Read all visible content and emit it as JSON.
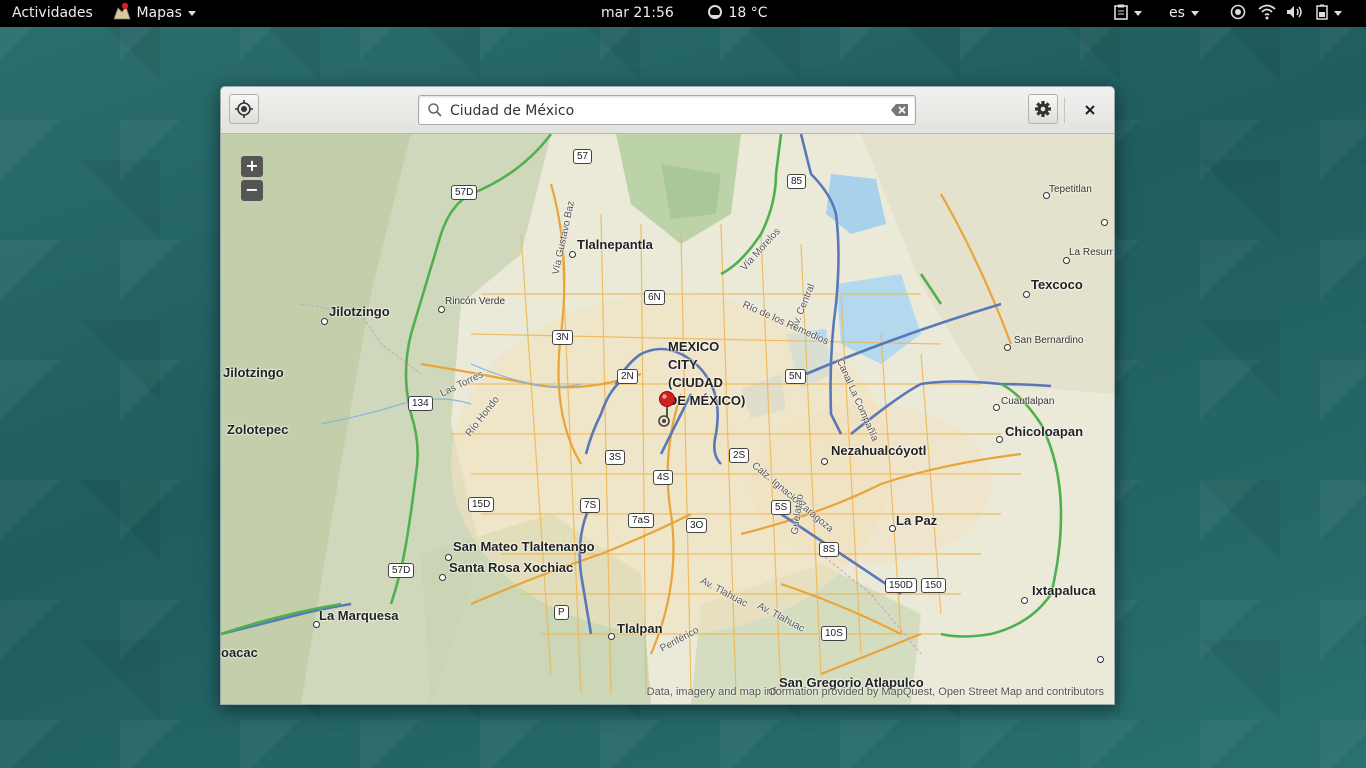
{
  "topbar": {
    "activities": "Actividades",
    "app_menu": "Mapas",
    "clock": "mar 21:56",
    "weather": "18 °C",
    "language": "es"
  },
  "window": {
    "search": {
      "value": "Ciudad de México"
    }
  },
  "map": {
    "labels": {
      "mexico_city_1": "MEXICO",
      "mexico_city_2": "CITY",
      "mexico_city_3": "(CIUDAD",
      "mexico_city_4": "DE MÉXICO)",
      "tlalnepantla": "Tlalnepantla",
      "jilotzingo_1": "Jilotzingo",
      "jilotzingo_2": "Jilotzingo",
      "zolotepec": "Zolotepec",
      "texcoco": "Texcoco",
      "nezahualcoyotl": "Nezahualcóyotl",
      "chicoloapan": "Chicoloapan",
      "la_paz": "La Paz",
      "ixtapaluca": "Ixtapaluca",
      "san_mateo": "San Mateo Tlaltenango",
      "santa_rosa": "Santa Rosa Xochiac",
      "la_marquesa": "La Marquesa",
      "tlalpan": "Tlalpan",
      "san_gregorio": "San Gregorio Atlapulco",
      "ocoyoacac": "oacac",
      "tepetitlan": "Tepetitlan",
      "la_resurreccion": "La Resurr",
      "san_bernardino": "San Bernardino",
      "cuautlalpan": "Cuautlalpan",
      "rincon_verde": "Rincón Verde"
    },
    "streets": {
      "via_gustavo_baz": "Vía Gustavo Baz",
      "via_morelos": "Vía Morelos",
      "av_central": "Av. Central",
      "rio_remedios": "Río de los Remedios",
      "canal_compania": "Canal La Compañía",
      "las_torres": "Las Torres",
      "rio_hondo": "Río Hondo",
      "calz_zaragoza": "Calz. Ignacio Zaragoza",
      "guelatao": "Guelatao",
      "av_tlahuac_1": "Av. Tlahuac",
      "av_tlahuac_2": "Av. Tlahuac",
      "periferico": "Periférico"
    },
    "shields": {
      "r57": "57",
      "r57d_1": "57D",
      "r57d_2": "57D",
      "r85": "85",
      "r6n": "6N",
      "r3n": "3N",
      "r2n": "2N",
      "r5n": "5N",
      "r134": "134",
      "r3s": "3S",
      "r4s": "4S",
      "r2s": "2S",
      "r15d": "15D",
      "r7s": "7S",
      "r7as": "7aS",
      "r3o": "3O",
      "r5s": "5S",
      "r8s": "8S",
      "r150d": "150D",
      "r150": "150",
      "rp": "P",
      "r10s": "10S"
    },
    "attribution": "Data, imagery and map information provided by MapQuest, Open Street Map and contributors"
  },
  "colors": {
    "topbar": "#000000",
    "map_land": "#e8e6d6",
    "major_road": "#f0b650",
    "highway": "#5a78b8",
    "toll_road": "#4fb04f",
    "pin": "#d11f1f"
  }
}
